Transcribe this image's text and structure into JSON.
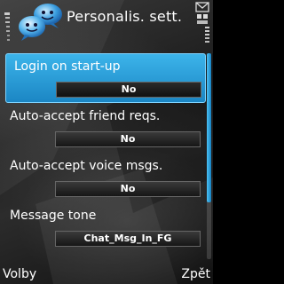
{
  "header": {
    "title": "Personalis. sett.",
    "app_icon": "chat-bubbles-icon",
    "left_indicator": "signal-strength-icon",
    "right_indicators": [
      "message-envelope-icon",
      "connection-icon",
      "battery-level-icon"
    ]
  },
  "settings": [
    {
      "label": "Login on start-up",
      "value": "No",
      "selected": true
    },
    {
      "label": "Auto-accept friend reqs.",
      "value": "No",
      "selected": false
    },
    {
      "label": "Auto-accept voice msgs.",
      "value": "No",
      "selected": false
    },
    {
      "label": "Message tone",
      "value": "Chat_Msg_In_FG",
      "selected": false
    }
  ],
  "softkeys": {
    "left": "Volby",
    "right": "Zpět"
  },
  "colors": {
    "highlight": "#2ba0da",
    "scroll_thumb": "#3cb4ea"
  }
}
